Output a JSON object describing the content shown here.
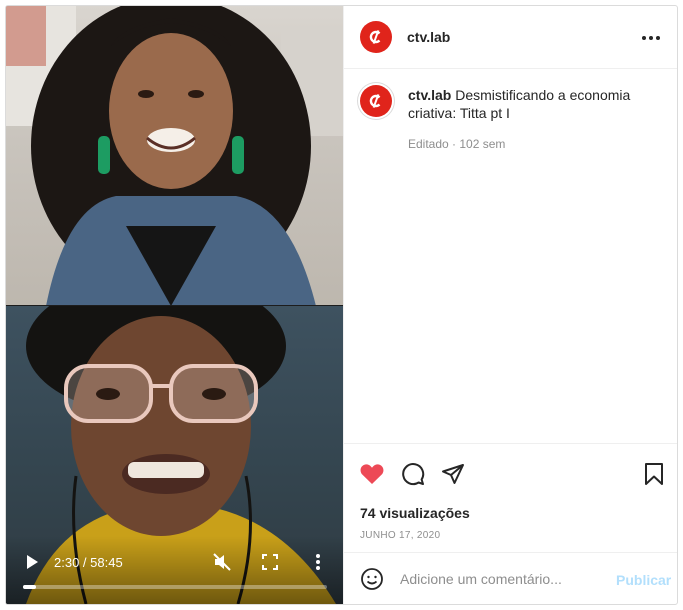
{
  "video": {
    "time_display": "2:30 / 58:45",
    "progress": 0.0426,
    "icons": {
      "play": "play-icon",
      "mute": "muted-speaker-icon",
      "fullscreen": "fullscreen-icon",
      "more": "vertical-dots-icon"
    }
  },
  "account": {
    "username": "ctv.lab",
    "avatar_color": "#e0241b"
  },
  "post": {
    "caption_username": "ctv.lab",
    "caption_text": " Desmistificando a economia criativa: Titta pt I",
    "meta": "Editado · 102 sem",
    "views": "74 visualizações",
    "date": "JUNHO 17, 2020",
    "liked": true,
    "like_color": "#ed4956"
  },
  "comment": {
    "placeholder": "Adicione um comentário...",
    "publish_label": "Publicar"
  }
}
